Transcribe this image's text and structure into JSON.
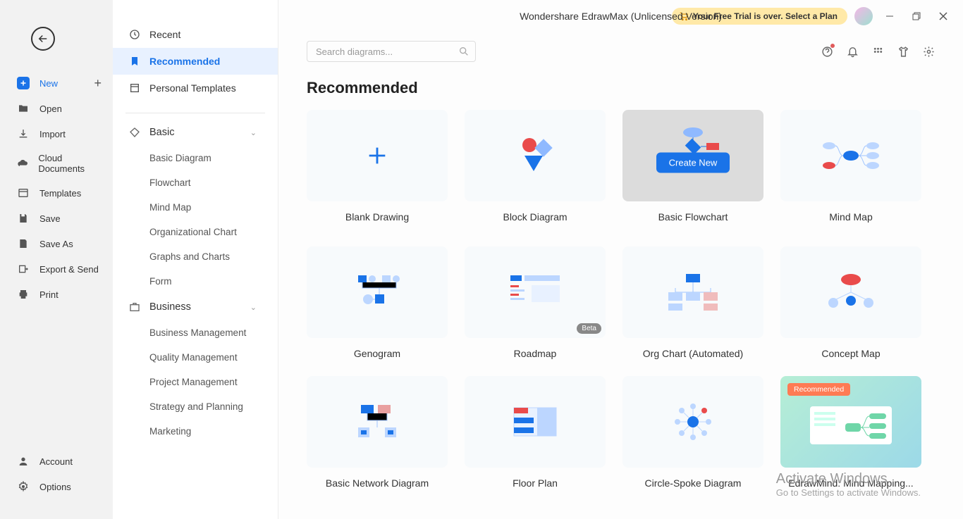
{
  "app_title": "Wondershare EdrawMax (Unlicensed Version)",
  "trial_text": "Your Free Trial is over. Select a Plan",
  "search": {
    "placeholder": "Search diagrams..."
  },
  "section_title": "Recommended",
  "create_btn": "Create New",
  "beta_label": "Beta",
  "recommended_badge": "Recommended",
  "sidebar_left": {
    "new": "New",
    "open": "Open",
    "import": "Import",
    "cloud": "Cloud Documents",
    "templates": "Templates",
    "save": "Save",
    "save_as": "Save As",
    "export": "Export & Send",
    "print": "Print",
    "account": "Account",
    "options": "Options"
  },
  "categories": {
    "top": [
      "Recent",
      "Recommended",
      "Personal Templates"
    ],
    "groups": [
      {
        "name": "Basic",
        "items": [
          "Basic Diagram",
          "Flowchart",
          "Mind Map",
          "Organizational Chart",
          "Graphs and Charts",
          "Form"
        ]
      },
      {
        "name": "Business",
        "items": [
          "Business Management",
          "Quality Management",
          "Project Management",
          "Strategy and Planning",
          "Marketing"
        ]
      }
    ]
  },
  "cards": [
    {
      "label": "Blank Drawing"
    },
    {
      "label": "Block Diagram"
    },
    {
      "label": "Basic Flowchart"
    },
    {
      "label": "Mind Map"
    },
    {
      "label": "Genogram"
    },
    {
      "label": "Roadmap"
    },
    {
      "label": "Org Chart (Automated)"
    },
    {
      "label": "Concept Map"
    },
    {
      "label": "Basic Network Diagram"
    },
    {
      "label": "Floor Plan"
    },
    {
      "label": "Circle-Spoke Diagram"
    },
    {
      "label": "EdrawMind: Mind Mapping..."
    }
  ],
  "watermark": {
    "l1": "Activate Windows",
    "l2": "Go to Settings to activate Windows."
  }
}
